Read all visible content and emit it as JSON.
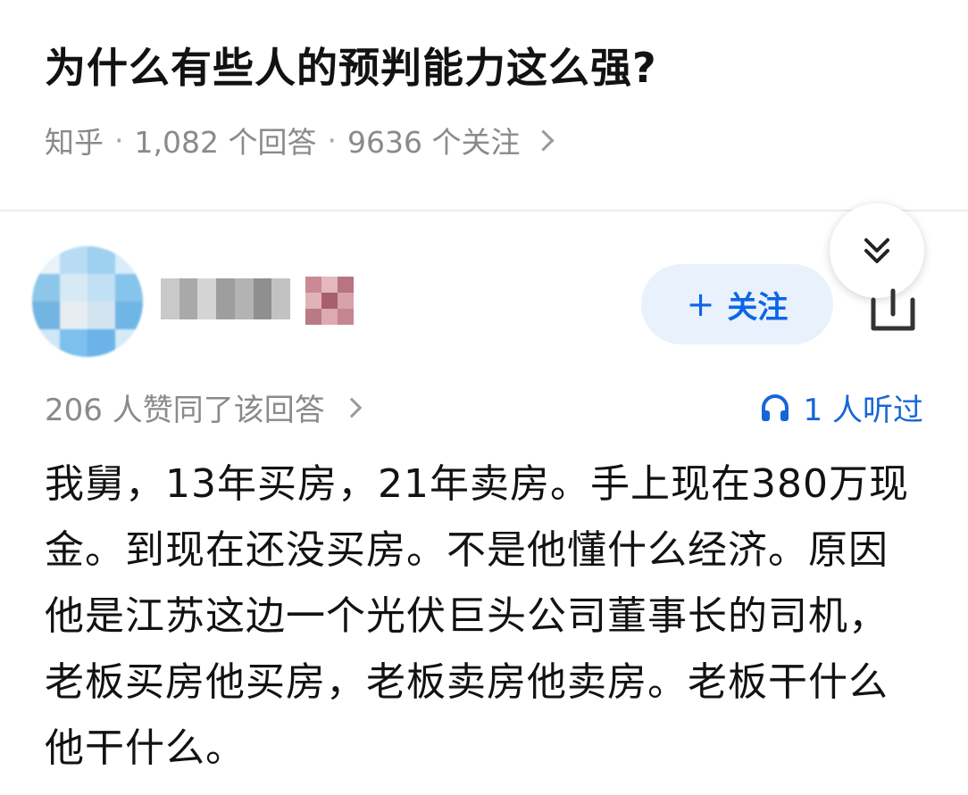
{
  "question": {
    "title": "为什么有些人的预判能力这么强?",
    "source": "知乎",
    "answers": "1,082 个回答",
    "follows": "9636 个关注"
  },
  "author": {
    "follow_label": "关注"
  },
  "answer": {
    "upvotes": "206 人赞同了该回答",
    "listened": "1 人听过",
    "content": "我舅，13年买房，21年卖房。手上现在380万现金。到现在还没买房。不是他懂什么经济。原因他是江苏这边一个光伏巨头公司董事长的司机，老板买房他买房，老板卖房他卖房。老板干什么他干什么。"
  },
  "icons": {
    "collapse": "double-chevron-down-icon",
    "share": "share-icon",
    "headphones": "headphones-icon",
    "plus": "plus-icon",
    "chevron": "chevron-right-icon"
  },
  "colors": {
    "accent": "#0c66e4",
    "follow_bg": "#e9f1fd",
    "meta_gray": "#8a8a8a",
    "text": "#121212"
  }
}
